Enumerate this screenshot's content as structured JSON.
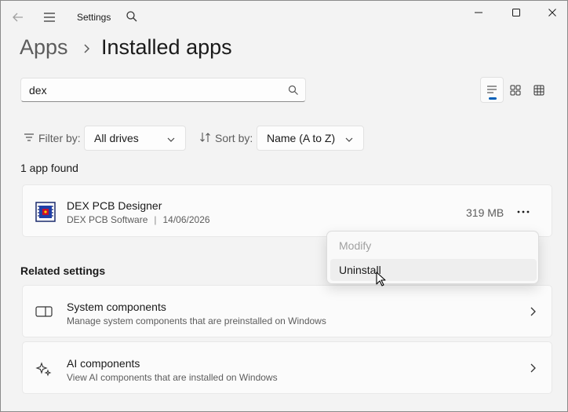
{
  "titlebar": {
    "title": "Settings",
    "icons": {
      "back": "back-arrow-icon",
      "menu": "hamburger-menu-icon",
      "search": "search-icon",
      "minimize": "minimize-icon",
      "maximize": "maximize-icon",
      "close": "close-icon"
    }
  },
  "breadcrumb": {
    "parent": "Apps",
    "current": "Installed apps"
  },
  "search": {
    "value": "dex",
    "placeholder": ""
  },
  "view_toggle": {
    "active": "list",
    "options": [
      "list",
      "grid",
      "table"
    ]
  },
  "filter": {
    "label": "Filter by:",
    "value": "All drives"
  },
  "sort": {
    "label": "Sort by:",
    "value": "Name (A to Z)"
  },
  "result_count": "1 app found",
  "apps": [
    {
      "name": "DEX PCB Designer",
      "publisher": "DEX PCB Software",
      "date": "14/06/2026",
      "size": "319 MB"
    }
  ],
  "context_menu": {
    "items": [
      {
        "label": "Modify",
        "enabled": false
      },
      {
        "label": "Uninstall",
        "enabled": true,
        "hovered": true
      }
    ]
  },
  "related": {
    "title": "Related settings",
    "items": [
      {
        "title": "System components",
        "description": "Manage system components that are preinstalled on Windows",
        "icon": "system-components-icon"
      },
      {
        "title": "AI components",
        "description": "View AI components that are installed on Windows",
        "icon": "sparkle-icon"
      }
    ]
  },
  "colors": {
    "accent": "#005fb8",
    "background": "#f3f3f3",
    "card": "#fbfbfb"
  }
}
